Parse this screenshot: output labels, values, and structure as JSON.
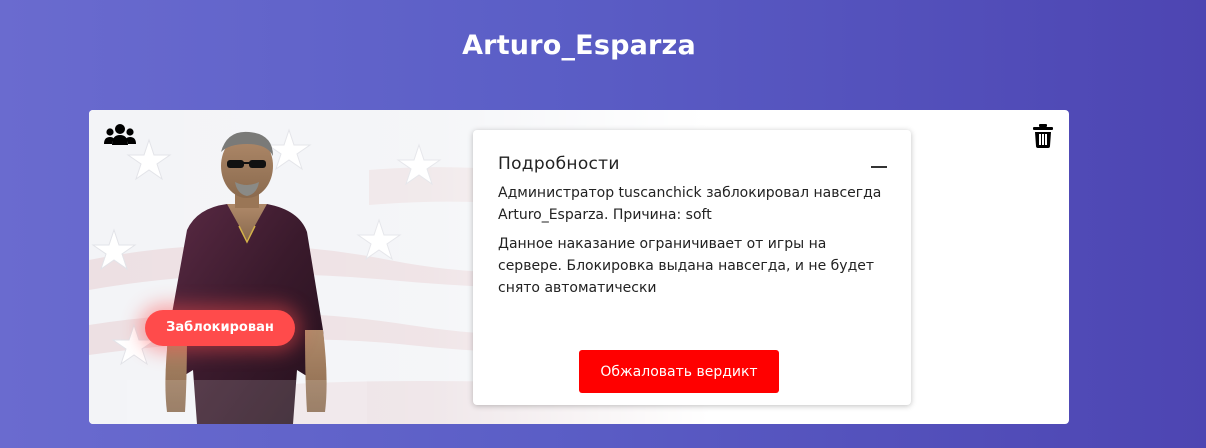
{
  "player": {
    "name": "Arturo_Esparza"
  },
  "card": {
    "status_label": "Заблокирован",
    "icons": {
      "group": "users-group-icon",
      "delete": "trash-icon"
    }
  },
  "details": {
    "heading": "Подробности",
    "ban_message": "Администратор tuscanchick заблокировал навсегда Arturo_Esparza. Причина: soft",
    "punishment_info": "Данное наказание ограничивает от игры на сервере. Блокировка выдана навсегда, и не будет снято автоматически",
    "appeal_button_label": "Обжаловать вердикт"
  },
  "colors": {
    "background_start": "#6a6bcf",
    "background_end": "#4d45b2",
    "status_badge": "#ff4b4b",
    "appeal_button": "#ff0000"
  }
}
